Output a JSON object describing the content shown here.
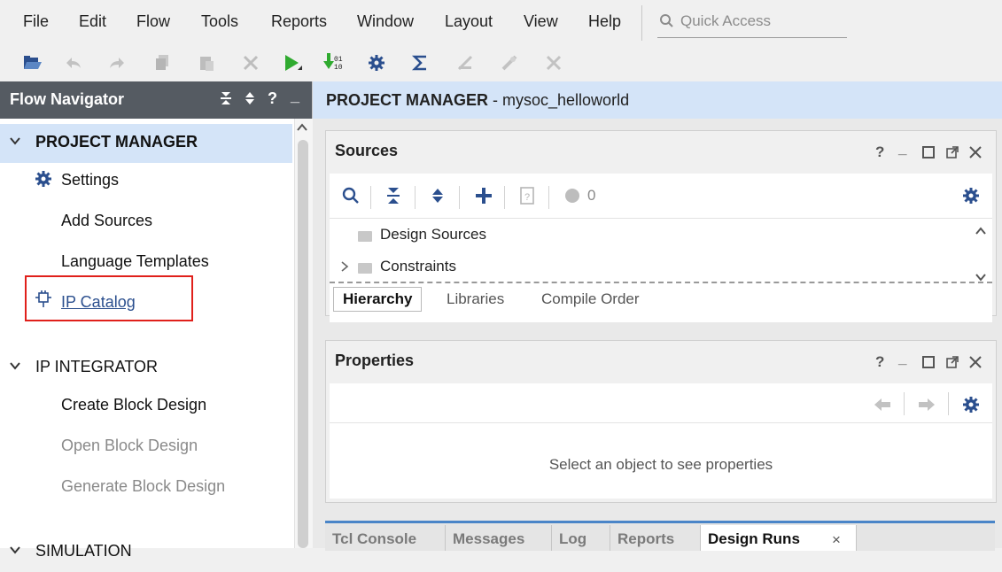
{
  "menubar": {
    "items": [
      {
        "label": "File"
      },
      {
        "label": "Edit"
      },
      {
        "label": "Flow"
      },
      {
        "label": "Tools"
      },
      {
        "label": "Reports"
      },
      {
        "label": "Window"
      },
      {
        "label": "Layout"
      },
      {
        "label": "View"
      },
      {
        "label": "Help"
      }
    ],
    "quick_access_placeholder": "Quick Access"
  },
  "toolbar": {
    "icons": [
      "open-project-icon",
      "undo-icon",
      "redo-icon",
      "copy-icon",
      "paste-icon",
      "delete-icon",
      "run-icon",
      "program-icon",
      "settings-icon",
      "sigma-icon",
      "disabled-icon-1",
      "disabled-icon-2",
      "disabled-icon-3"
    ],
    "program_digits": "01\n10"
  },
  "flow_navigator": {
    "title": "Flow Navigator",
    "sections": [
      {
        "label": "PROJECT MANAGER",
        "expanded": true,
        "selected": true,
        "items": [
          {
            "label": "Settings",
            "icon": "gear-icon",
            "enabled": true
          },
          {
            "label": "Add Sources",
            "enabled": true
          },
          {
            "label": "Language Templates",
            "enabled": true
          },
          {
            "label": "IP Catalog",
            "icon": "ip-catalog-icon",
            "enabled": true,
            "link": true
          }
        ]
      },
      {
        "label": "IP INTEGRATOR",
        "expanded": true,
        "items": [
          {
            "label": "Create Block Design",
            "enabled": true
          },
          {
            "label": "Open Block Design",
            "enabled": false
          },
          {
            "label": "Generate Block Design",
            "enabled": false
          }
        ]
      },
      {
        "label": "SIMULATION",
        "expanded": true
      }
    ]
  },
  "project_manager": {
    "title": "PROJECT MANAGER",
    "project_name": "mysoc_helloworld",
    "separator": " - "
  },
  "sources": {
    "title": "Sources",
    "error_count": "0",
    "tree": [
      {
        "label": "Design Sources",
        "expandable": false
      },
      {
        "label": "Constraints",
        "expandable": true
      }
    ],
    "tabs": [
      "Hierarchy",
      "Libraries",
      "Compile Order"
    ],
    "active_tab": "Hierarchy"
  },
  "properties": {
    "title": "Properties",
    "empty_message": "Select an object to see properties"
  },
  "console": {
    "tabs": [
      "Tcl Console",
      "Messages",
      "Log",
      "Reports",
      "Design Runs"
    ],
    "active_tab": "Design Runs",
    "close_glyph": "×"
  },
  "window_controls": {
    "help": "?",
    "minimize": "_"
  },
  "colors": {
    "nav_header": "#555b62",
    "selected_row": "#d4e4f8",
    "highlight_box": "#e0201b",
    "accent_blue": "#2b4f8e",
    "run_green": "#2faa2f"
  }
}
